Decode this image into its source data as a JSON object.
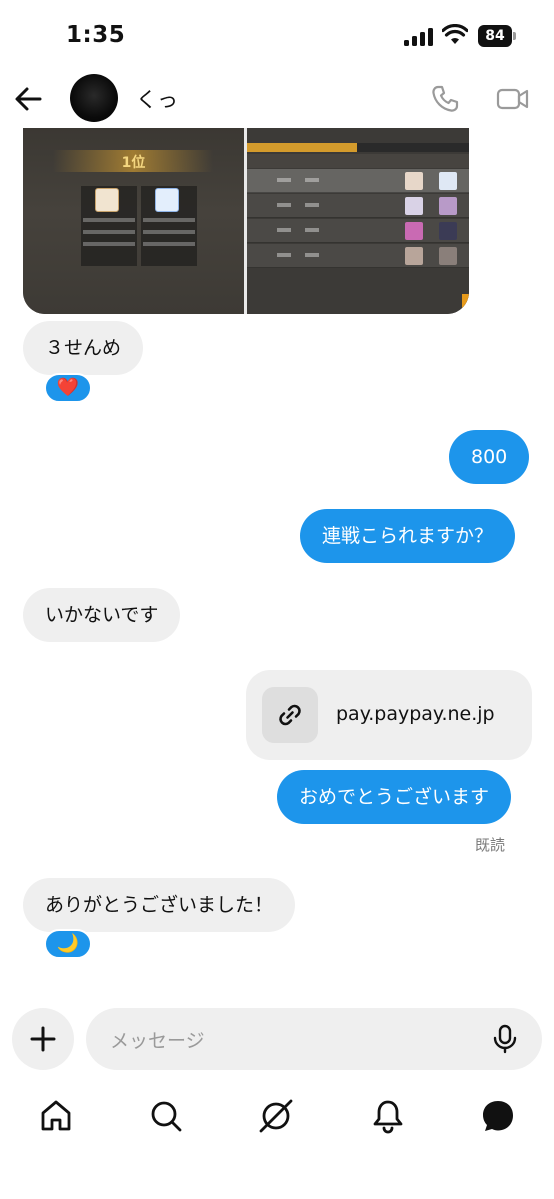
{
  "status_bar": {
    "time": "1:35",
    "battery": "84"
  },
  "header": {
    "contact_name": "くっ",
    "back_icon": "back-arrow-icon",
    "call_icon": "phone-icon",
    "video_icon": "video-camera-icon"
  },
  "shared_image": {
    "rank_label": "1位"
  },
  "messages": [
    {
      "id": "m1",
      "direction": "incoming",
      "text": "３せんめ",
      "reaction": "❤️"
    },
    {
      "id": "m2",
      "direction": "outgoing",
      "text": "800"
    },
    {
      "id": "m3",
      "direction": "outgoing",
      "text": "連戦こられますか？"
    },
    {
      "id": "m4",
      "direction": "incoming",
      "text": "いかないです"
    },
    {
      "id": "m5",
      "direction": "outgoing",
      "type": "link",
      "text": "pay.paypay.ne.jp",
      "icon": "link-icon"
    },
    {
      "id": "m6",
      "direction": "outgoing",
      "text": "おめでとうございます"
    },
    {
      "id": "m7",
      "direction": "incoming",
      "text": "ありがとうございました！",
      "reaction": "🌙"
    }
  ],
  "read_receipt": "既読",
  "composer": {
    "placeholder": "メッセージ",
    "add_icon": "plus-icon",
    "mic_icon": "microphone-icon"
  },
  "bottom_nav": [
    {
      "name": "home",
      "icon": "home-icon"
    },
    {
      "name": "search",
      "icon": "search-icon"
    },
    {
      "name": "explore",
      "icon": "compass-icon"
    },
    {
      "name": "notifications",
      "icon": "bell-icon"
    },
    {
      "name": "messages",
      "icon": "chat-bubble-icon"
    }
  ],
  "colors": {
    "accent_blue": "#1d95eb",
    "incoming_bubble": "#efefef",
    "read_receipt": "#7a7a7a"
  }
}
